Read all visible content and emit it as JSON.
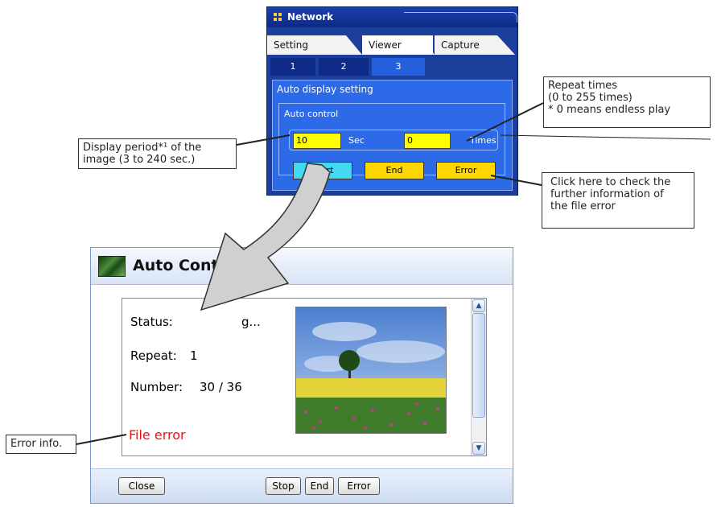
{
  "network_panel": {
    "title": "Network",
    "tabs": [
      "Setting",
      "Viewer",
      "Capture"
    ],
    "subtabs": [
      "1",
      "2",
      "3"
    ],
    "section_label": "Auto display setting",
    "auto_control_label": "Auto control",
    "period_value": "10",
    "period_unit": "Sec",
    "repeat_value": "0",
    "repeat_unit": "Times",
    "buttons": {
      "start": "Start",
      "end": "End",
      "error": "Error"
    },
    "colors": {
      "panel": "#1c3f9c",
      "field": "#ffff00",
      "start": "#44d9f2",
      "button": "#ffd700"
    }
  },
  "callouts": {
    "display_period": [
      "Display period*¹ of the",
      "image (3 to 240 sec.)"
    ],
    "repeat_times": [
      "Repeat times",
      "(0 to 255 times)",
      "* 0 means endless play"
    ],
    "error_check": [
      "Click here to check the",
      "further information of",
      "the file error"
    ],
    "error_info": "Error info."
  },
  "dialog": {
    "title": "Auto Control",
    "status_label": "Status:",
    "status_value": "g...",
    "repeat_label": "Repeat:",
    "repeat_value": "1",
    "number_label": "Number:",
    "number_value": "30 / 36",
    "error_text": "File error",
    "buttons": {
      "close": "Close",
      "stop": "Stop",
      "end": "End",
      "error": "Error"
    },
    "scroll_icons": {
      "up": "arrow-up-icon",
      "down": "arrow-down-icon"
    },
    "colors": {
      "error": "#ee1111",
      "footer": "#cddcf2"
    }
  }
}
